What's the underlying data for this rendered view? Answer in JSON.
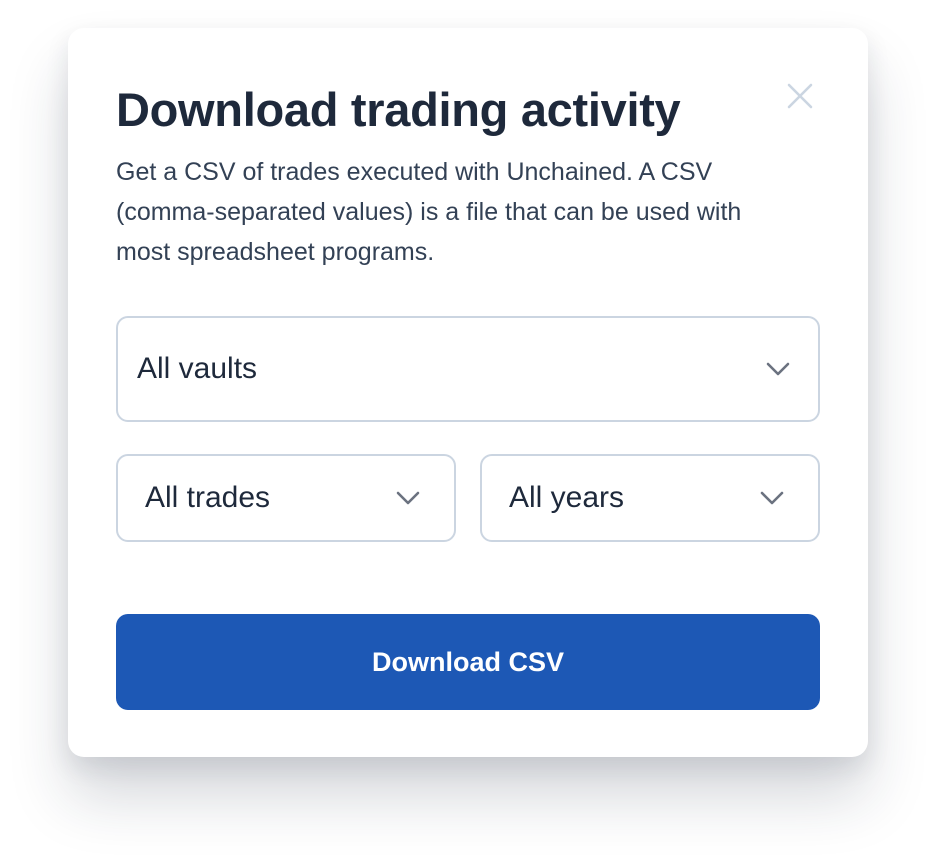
{
  "dialog": {
    "title": "Download trading activity",
    "description": "Get a CSV of trades executed with Unchained. A CSV (comma-separated values) is a file that can be used with most spreadsheet programs.",
    "close_icon": "close-icon"
  },
  "filters": {
    "vaults": {
      "selected": "All vaults",
      "icon": "chevron-down-icon"
    },
    "trades": {
      "selected": "All trades",
      "icon": "chevron-down-icon"
    },
    "years": {
      "selected": "All years",
      "icon": "chevron-down-icon"
    }
  },
  "actions": {
    "download_label": "Download CSV"
  },
  "colors": {
    "primary": "#1d58b5",
    "text": "#1e293b",
    "border": "#cbd5e1",
    "close_icon": "#cbd5e1"
  }
}
